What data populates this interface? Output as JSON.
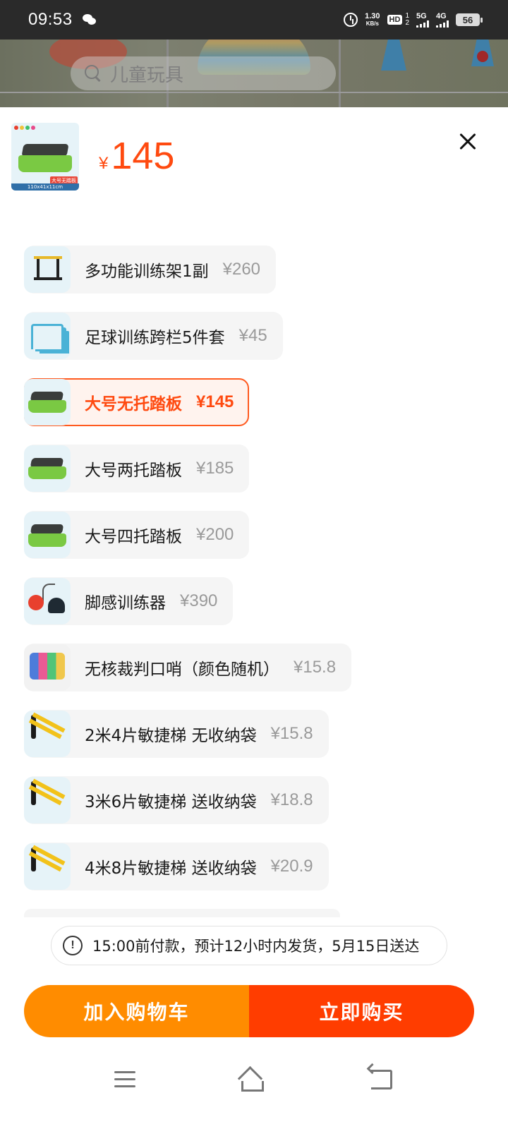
{
  "status_bar": {
    "time": "09:53",
    "speed_value": "1.30",
    "speed_unit": "KB/s",
    "hd_label": "HD",
    "hd_sub_top": "1",
    "hd_sub_bottom": "2",
    "net_5g": "5G",
    "net_4g": "4G",
    "battery": "56"
  },
  "backdrop": {
    "search_placeholder": "儿童玩具"
  },
  "selected_product": {
    "currency": "¥",
    "price": "145",
    "thumb_size_tag": "110x41x11cm",
    "thumb_name_tag": "大号无踏板"
  },
  "options": [
    {
      "name": "多功能训练架1副",
      "price": "¥260",
      "selected": false,
      "icon": "training-rack-icon"
    },
    {
      "name": "足球训练跨栏5件套",
      "price": "¥45",
      "selected": false,
      "icon": "hurdles-icon"
    },
    {
      "name": "大号无托踏板",
      "price": "¥145",
      "selected": true,
      "icon": "step-board-icon"
    },
    {
      "name": "大号两托踏板",
      "price": "¥185",
      "selected": false,
      "icon": "step-board-icon"
    },
    {
      "name": "大号四托踏板",
      "price": "¥200",
      "selected": false,
      "icon": "step-board-icon"
    },
    {
      "name": "脚感训练器",
      "price": "¥390",
      "selected": false,
      "icon": "kick-trainer-icon"
    },
    {
      "name": "无核裁判口哨（颜色随机）",
      "price": "¥15.8",
      "selected": false,
      "icon": "whistle-icon"
    },
    {
      "name": "2米4片敏捷梯 无收纳袋",
      "price": "¥15.8",
      "selected": false,
      "icon": "agility-ladder-icon"
    },
    {
      "name": "3米6片敏捷梯 送收纳袋",
      "price": "¥18.8",
      "selected": false,
      "icon": "agility-ladder-icon"
    },
    {
      "name": "4米8片敏捷梯 送收纳袋",
      "price": "¥20.9",
      "selected": false,
      "icon": "agility-ladder-icon"
    }
  ],
  "notice": {
    "icon": "alert-icon",
    "mark": "!",
    "text": "15:00前付款，预计12小时内发货，5月15日送达"
  },
  "actions": {
    "add_to_cart": "加入购物车",
    "buy_now": "立即购买"
  },
  "colors": {
    "accent": "#ff4a10",
    "cart_button": "#ff8c00",
    "buy_button": "#ff3d00",
    "option_bg": "#f5f5f5",
    "muted_price": "#9a9a9a"
  }
}
